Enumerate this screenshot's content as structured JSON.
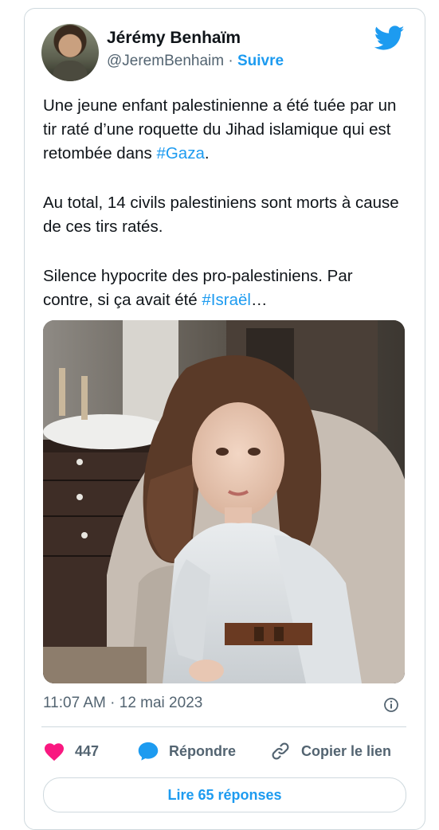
{
  "author": {
    "name": "Jérémy Benhaïm",
    "handle": "@JeremBenhaim",
    "separator": "·",
    "follow_label": "Suivre"
  },
  "tweet": {
    "paragraphs": [
      {
        "text": "Une jeune enfant palestinienne a été tuée par un tir raté d’une roquette du Jihad islamique qui est retombée dans ",
        "hashtag": "#Gaza",
        "suffix": "."
      },
      {
        "text": "Au total, 14 civils palestiniens sont morts à cause de ces tirs ratés.",
        "hashtag": "",
        "suffix": ""
      },
      {
        "text": "Silence hypocrite des pro-palestiniens. Par contre, si ça avait été ",
        "hashtag": "#Israël",
        "suffix": "…"
      }
    ],
    "timestamp": "11:07 AM · 12 mai 2023"
  },
  "actions": {
    "likes_count": "447",
    "reply_label": "Répondre",
    "copy_link_label": "Copier le lien"
  },
  "read_replies_label": "Lire 65 réponses",
  "colors": {
    "accent": "#1d9bf0",
    "like": "#f91880",
    "text": "#0f1419",
    "muted": "#536471",
    "border": "#cfd9de"
  },
  "icons": [
    "twitter-bird-icon",
    "info-icon",
    "heart-icon",
    "reply-bubble-icon",
    "link-icon"
  ]
}
